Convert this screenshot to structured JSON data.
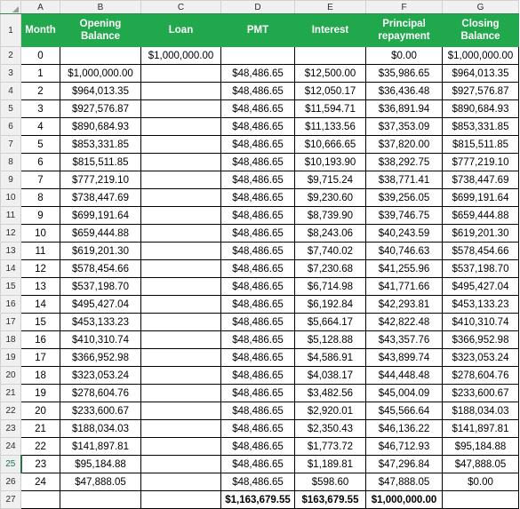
{
  "spreadsheet": {
    "column_letters": [
      "A",
      "B",
      "C",
      "D",
      "E",
      "F",
      "G"
    ],
    "active_row": "25",
    "accent_color": "#21A84C",
    "header_text_color": "#FFFFFF",
    "headers": {
      "month": "Month",
      "opening_balance": "Opening Balance",
      "loan": "Loan",
      "pmt": "PMT",
      "interest": "Interest",
      "principal_repayment": "Principal repayment",
      "closing_balance": "Closing Balance"
    },
    "row_numbers": [
      "1",
      "2",
      "3",
      "4",
      "5",
      "6",
      "7",
      "8",
      "9",
      "10",
      "11",
      "12",
      "13",
      "14",
      "15",
      "16",
      "17",
      "18",
      "19",
      "20",
      "21",
      "22",
      "23",
      "24",
      "25",
      "26",
      "27"
    ],
    "rows": [
      {
        "row": "2",
        "month": "0",
        "opening": "",
        "loan": "$1,000,000.00",
        "pmt": "",
        "interest": "",
        "principal": "$0.00",
        "closing": "$1,000,000.00"
      },
      {
        "row": "3",
        "month": "1",
        "opening": "$1,000,000.00",
        "loan": "",
        "pmt": "$48,486.65",
        "interest": "$12,500.00",
        "principal": "$35,986.65",
        "closing": "$964,013.35"
      },
      {
        "row": "4",
        "month": "2",
        "opening": "$964,013.35",
        "loan": "",
        "pmt": "$48,486.65",
        "interest": "$12,050.17",
        "principal": "$36,436.48",
        "closing": "$927,576.87"
      },
      {
        "row": "5",
        "month": "3",
        "opening": "$927,576.87",
        "loan": "",
        "pmt": "$48,486.65",
        "interest": "$11,594.71",
        "principal": "$36,891.94",
        "closing": "$890,684.93"
      },
      {
        "row": "6",
        "month": "4",
        "opening": "$890,684.93",
        "loan": "",
        "pmt": "$48,486.65",
        "interest": "$11,133.56",
        "principal": "$37,353.09",
        "closing": "$853,331.85"
      },
      {
        "row": "7",
        "month": "5",
        "opening": "$853,331.85",
        "loan": "",
        "pmt": "$48,486.65",
        "interest": "$10,666.65",
        "principal": "$37,820.00",
        "closing": "$815,511.85"
      },
      {
        "row": "8",
        "month": "6",
        "opening": "$815,511.85",
        "loan": "",
        "pmt": "$48,486.65",
        "interest": "$10,193.90",
        "principal": "$38,292.75",
        "closing": "$777,219.10"
      },
      {
        "row": "9",
        "month": "7",
        "opening": "$777,219.10",
        "loan": "",
        "pmt": "$48,486.65",
        "interest": "$9,715.24",
        "principal": "$38,771.41",
        "closing": "$738,447.69"
      },
      {
        "row": "10",
        "month": "8",
        "opening": "$738,447.69",
        "loan": "",
        "pmt": "$48,486.65",
        "interest": "$9,230.60",
        "principal": "$39,256.05",
        "closing": "$699,191.64"
      },
      {
        "row": "11",
        "month": "9",
        "opening": "$699,191.64",
        "loan": "",
        "pmt": "$48,486.65",
        "interest": "$8,739.90",
        "principal": "$39,746.75",
        "closing": "$659,444.88"
      },
      {
        "row": "12",
        "month": "10",
        "opening": "$659,444.88",
        "loan": "",
        "pmt": "$48,486.65",
        "interest": "$8,243.06",
        "principal": "$40,243.59",
        "closing": "$619,201.30"
      },
      {
        "row": "13",
        "month": "11",
        "opening": "$619,201.30",
        "loan": "",
        "pmt": "$48,486.65",
        "interest": "$7,740.02",
        "principal": "$40,746.63",
        "closing": "$578,454.66"
      },
      {
        "row": "14",
        "month": "12",
        "opening": "$578,454.66",
        "loan": "",
        "pmt": "$48,486.65",
        "interest": "$7,230.68",
        "principal": "$41,255.96",
        "closing": "$537,198.70"
      },
      {
        "row": "15",
        "month": "13",
        "opening": "$537,198.70",
        "loan": "",
        "pmt": "$48,486.65",
        "interest": "$6,714.98",
        "principal": "$41,771.66",
        "closing": "$495,427.04"
      },
      {
        "row": "16",
        "month": "14",
        "opening": "$495,427.04",
        "loan": "",
        "pmt": "$48,486.65",
        "interest": "$6,192.84",
        "principal": "$42,293.81",
        "closing": "$453,133.23"
      },
      {
        "row": "17",
        "month": "15",
        "opening": "$453,133.23",
        "loan": "",
        "pmt": "$48,486.65",
        "interest": "$5,664.17",
        "principal": "$42,822.48",
        "closing": "$410,310.74"
      },
      {
        "row": "18",
        "month": "16",
        "opening": "$410,310.74",
        "loan": "",
        "pmt": "$48,486.65",
        "interest": "$5,128.88",
        "principal": "$43,357.76",
        "closing": "$366,952.98"
      },
      {
        "row": "19",
        "month": "17",
        "opening": "$366,952.98",
        "loan": "",
        "pmt": "$48,486.65",
        "interest": "$4,586.91",
        "principal": "$43,899.74",
        "closing": "$323,053.24"
      },
      {
        "row": "20",
        "month": "18",
        "opening": "$323,053.24",
        "loan": "",
        "pmt": "$48,486.65",
        "interest": "$4,038.17",
        "principal": "$44,448.48",
        "closing": "$278,604.76"
      },
      {
        "row": "21",
        "month": "19",
        "opening": "$278,604.76",
        "loan": "",
        "pmt": "$48,486.65",
        "interest": "$3,482.56",
        "principal": "$45,004.09",
        "closing": "$233,600.67"
      },
      {
        "row": "22",
        "month": "20",
        "opening": "$233,600.67",
        "loan": "",
        "pmt": "$48,486.65",
        "interest": "$2,920.01",
        "principal": "$45,566.64",
        "closing": "$188,034.03"
      },
      {
        "row": "23",
        "month": "21",
        "opening": "$188,034.03",
        "loan": "",
        "pmt": "$48,486.65",
        "interest": "$2,350.43",
        "principal": "$46,136.22",
        "closing": "$141,897.81"
      },
      {
        "row": "24",
        "month": "22",
        "opening": "$141,897.81",
        "loan": "",
        "pmt": "$48,486.65",
        "interest": "$1,773.72",
        "principal": "$46,712.93",
        "closing": "$95,184.88"
      },
      {
        "row": "25",
        "month": "23",
        "opening": "$95,184.88",
        "loan": "",
        "pmt": "$48,486.65",
        "interest": "$1,189.81",
        "principal": "$47,296.84",
        "closing": "$47,888.05"
      },
      {
        "row": "26",
        "month": "24",
        "opening": "$47,888.05",
        "loan": "",
        "pmt": "$48,486.65",
        "interest": "$598.60",
        "principal": "$47,888.05",
        "closing": "$0.00"
      }
    ],
    "totals": {
      "row": "27",
      "month": "",
      "opening": "",
      "loan": "",
      "pmt": "$1,163,679.55",
      "interest": "$163,679.55",
      "principal": "$1,000,000.00",
      "closing": ""
    }
  }
}
